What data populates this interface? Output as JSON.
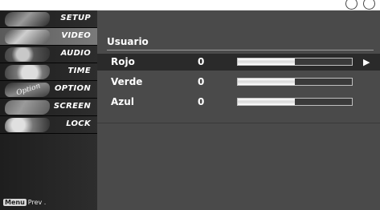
{
  "menu": {
    "items": [
      {
        "label": "SETUP",
        "thumb_text": ""
      },
      {
        "label": "VIDEO",
        "thumb_text": ""
      },
      {
        "label": "AUDIO",
        "thumb_text": ""
      },
      {
        "label": "TIME",
        "thumb_text": ""
      },
      {
        "label": "OPTION",
        "thumb_text": "Option"
      },
      {
        "label": "SCREEN",
        "thumb_text": ""
      },
      {
        "label": "LOCK",
        "thumb_text": ""
      }
    ],
    "selected_index": 1,
    "prev_key": "Menu",
    "prev_label": "Prev ."
  },
  "panel": {
    "title": "Usuario",
    "rows": [
      {
        "label": "Rojo",
        "value": "0",
        "level": 0.5
      },
      {
        "label": "Verde",
        "value": "0",
        "level": 0.5
      },
      {
        "label": "Azul",
        "value": "0",
        "level": 0.5
      }
    ],
    "arrow": "▶"
  },
  "colors": {
    "background": "#4a4a4a",
    "highlight_row": "#2a2a2a",
    "bar_fill": "#ffffff"
  }
}
